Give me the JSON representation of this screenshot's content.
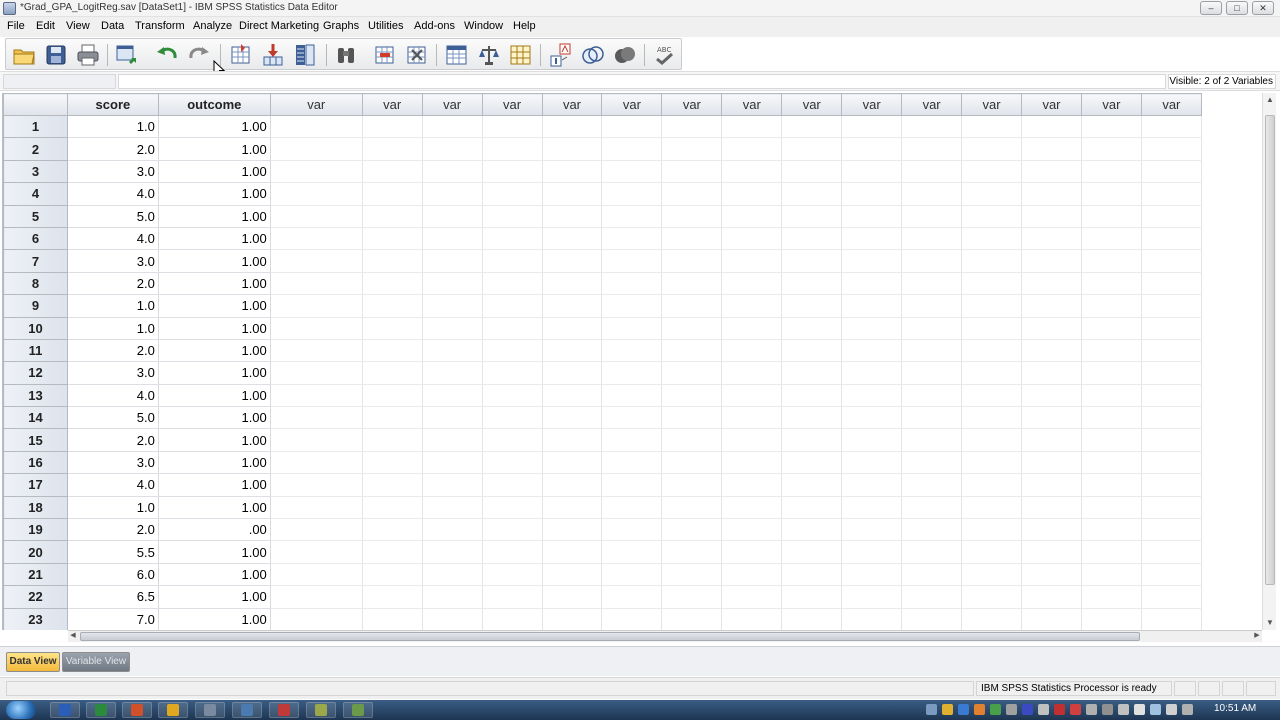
{
  "window": {
    "title": "*Grad_GPA_LogitReg.sav [DataSet1] - IBM SPSS Statistics Data Editor",
    "controls": {
      "minimize": "–",
      "maximize": "□",
      "close": "✕"
    }
  },
  "menu": [
    "File",
    "Edit",
    "View",
    "Data",
    "Transform",
    "Analyze",
    "Direct Marketing",
    "Graphs",
    "Utilities",
    "Add-ons",
    "Window",
    "Help"
  ],
  "toolbar": {
    "buttons": [
      "open-icon",
      "save-icon",
      "print-icon",
      "dialog-recall-icon",
      "undo-icon",
      "redo-icon",
      "goto-case-icon",
      "goto-variable-icon",
      "variables-icon",
      "find-icon",
      "insert-cases-icon",
      "insert-variable-icon",
      "split-file-icon",
      "weight-cases-icon",
      "select-cases-icon",
      "value-labels-icon",
      "use-variable-sets-icon",
      "show-all-variables-icon",
      "spell-check-icon"
    ]
  },
  "editor": {
    "cell_ref": "",
    "cell_value": "",
    "visible_text": "Visible: 2 of 2 Variables"
  },
  "grid": {
    "columns": [
      "score",
      "outcome",
      "var",
      "var",
      "var",
      "var",
      "var",
      "var",
      "var",
      "var",
      "var",
      "var",
      "var",
      "var",
      "var",
      "var",
      "var"
    ],
    "rows": [
      [
        "1",
        "1.0",
        "1.00"
      ],
      [
        "2",
        "2.0",
        "1.00"
      ],
      [
        "3",
        "3.0",
        "1.00"
      ],
      [
        "4",
        "4.0",
        "1.00"
      ],
      [
        "5",
        "5.0",
        "1.00"
      ],
      [
        "6",
        "4.0",
        "1.00"
      ],
      [
        "7",
        "3.0",
        "1.00"
      ],
      [
        "8",
        "2.0",
        "1.00"
      ],
      [
        "9",
        "1.0",
        "1.00"
      ],
      [
        "10",
        "1.0",
        "1.00"
      ],
      [
        "11",
        "2.0",
        "1.00"
      ],
      [
        "12",
        "3.0",
        "1.00"
      ],
      [
        "13",
        "4.0",
        "1.00"
      ],
      [
        "14",
        "5.0",
        "1.00"
      ],
      [
        "15",
        "2.0",
        "1.00"
      ],
      [
        "16",
        "3.0",
        "1.00"
      ],
      [
        "17",
        "4.0",
        "1.00"
      ],
      [
        "18",
        "1.0",
        "1.00"
      ],
      [
        "19",
        "2.0",
        ".00"
      ],
      [
        "20",
        "5.5",
        "1.00"
      ],
      [
        "21",
        "6.0",
        "1.00"
      ],
      [
        "22",
        "6.5",
        "1.00"
      ],
      [
        "23",
        "7.0",
        "1.00"
      ]
    ]
  },
  "tabs": {
    "data_view": "Data View",
    "variable_view": "Variable View"
  },
  "status": {
    "message": "IBM SPSS Statistics Processor is ready"
  },
  "taskbar": {
    "clock": "10:51 AM"
  }
}
